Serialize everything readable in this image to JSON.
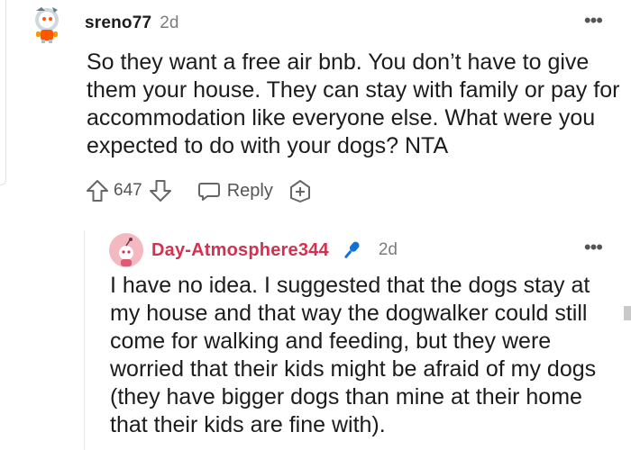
{
  "comments": [
    {
      "username": "sreno77",
      "age": "2d",
      "more": "•••",
      "text": "So they want a free air bnb. You don’t have to give them your house. They can stay with family or pay for accommodation like everyone else. What were you expected to do with your dogs? NTA",
      "votes": "647",
      "reply_label": "Reply",
      "icons": {
        "avatar": "snoo-avatar",
        "upvote": "arrow-up-icon",
        "downvote": "arrow-down-icon",
        "reply": "speech-bubble-icon",
        "award": "plus-circle-icon"
      }
    },
    {
      "username": "Day-Atmosphere344",
      "age": "2d",
      "more": "•••",
      "text": "I have no idea. I suggested that the dogs stay at my house and that way the dogwalker could still come for walking and feeding, but they were worried that their kids might be afraid of my dogs (they have bigger dogs than mine at their home that their kids are fine with).",
      "icons": {
        "avatar": "pink-snoo-avatar",
        "badge": "microphone-icon"
      },
      "username_color": "#d2324f"
    }
  ],
  "colors": {
    "text": "#1c1c1c",
    "muted": "#7c7c7c",
    "op_username": "#d2324f",
    "mic_blue": "#0f72d6"
  }
}
